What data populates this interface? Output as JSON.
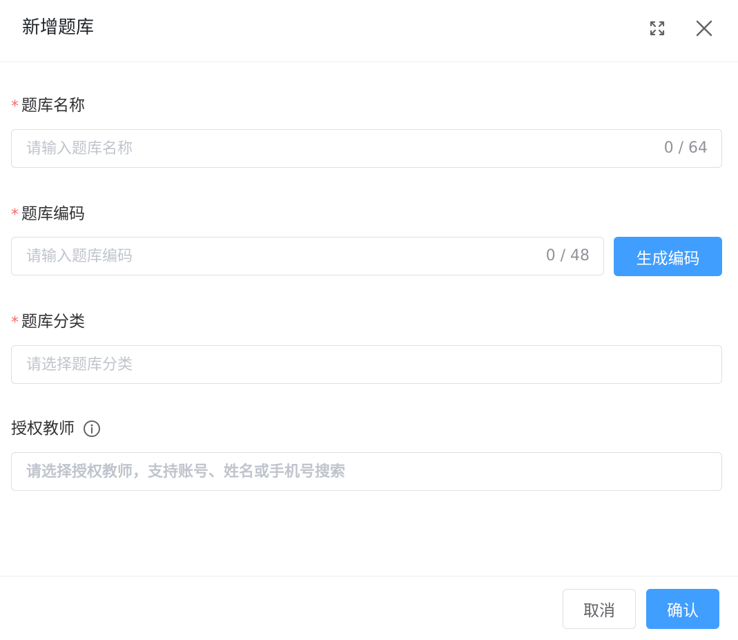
{
  "dialog": {
    "title": "新增题库",
    "fullscreen_icon": "fullscreen-icon",
    "close_icon": "close-icon"
  },
  "form": {
    "name": {
      "required_mark": "*",
      "label": "题库名称",
      "placeholder": "请输入题库名称",
      "value": "",
      "counter": "0 / 64"
    },
    "code": {
      "required_mark": "*",
      "label": "题库编码",
      "placeholder": "请输入题库编码",
      "value": "",
      "counter": "0 / 48",
      "generate_label": "生成编码"
    },
    "category": {
      "required_mark": "*",
      "label": "题库分类",
      "placeholder": "请选择题库分类",
      "value": ""
    },
    "teachers": {
      "label": "授权教师",
      "info_icon": "info-circle-icon",
      "placeholder": "请选择授权教师，支持账号、姓名或手机号搜索",
      "value": ""
    }
  },
  "footer": {
    "cancel_label": "取消",
    "confirm_label": "确认"
  },
  "colors": {
    "primary": "#409eff",
    "required": "#f56c6c",
    "border": "#dcdfe6",
    "placeholder": "#c0c4cc"
  }
}
